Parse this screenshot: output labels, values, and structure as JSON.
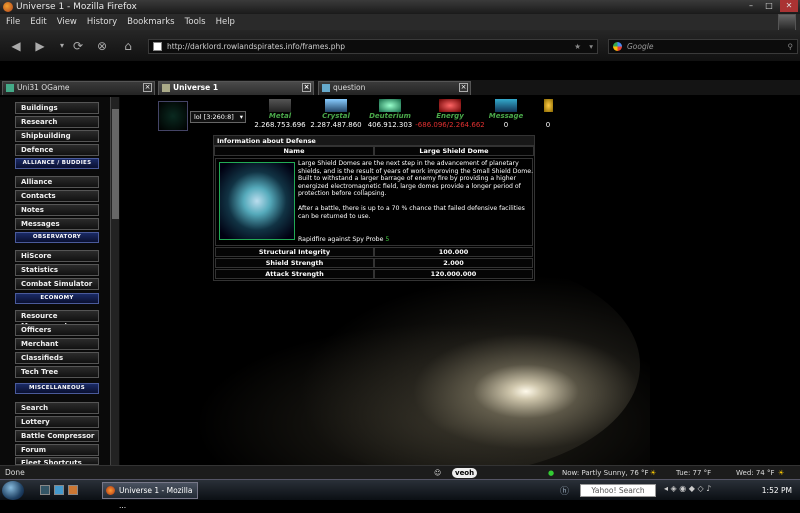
{
  "window": {
    "title": "Universe 1 - Mozilla Firefox"
  },
  "menu": [
    "File",
    "Edit",
    "View",
    "History",
    "Bookmarks",
    "Tools",
    "Help"
  ],
  "nav": {
    "url": "http://darklord.rowlandspirates.info/frames.php",
    "search_placeholder": "Google"
  },
  "tabs": [
    {
      "label": "Uni31 OGame",
      "active": false
    },
    {
      "label": "Universe 1",
      "active": true
    },
    {
      "label": "question",
      "active": false
    }
  ],
  "sidebar": {
    "items": [
      "Buildings",
      "Research",
      "Shipbuilding",
      "Defence"
    ],
    "header1": "ALLIANCE / BUDDIES",
    "items2": [
      "Alliance",
      "Contacts",
      "Notes",
      "Messages"
    ],
    "header2": "OBSERVATORY",
    "items3": [
      "HiScore",
      "Statistics",
      "Combat Simulator"
    ],
    "header3": "ECONOMY",
    "items4": [
      "Resource Managment",
      "Officers",
      "Merchant",
      "Classifieds",
      "Tech Tree"
    ],
    "header4": "MISCELLANEOUS",
    "items5": [
      "Search",
      "Lottery",
      "Battle Compressor",
      "Forum",
      "Fleet Shortcuts"
    ]
  },
  "planet": {
    "selector": "lol [3:260:8]"
  },
  "resources": [
    {
      "name": "Metal",
      "value": "2.268.753.696",
      "color": "#4aa84a"
    },
    {
      "name": "Crystal",
      "value": "2.287.487.860",
      "color": "#4aa84a"
    },
    {
      "name": "Deuterium",
      "value": "406.912.303",
      "color": "#4aa84a"
    },
    {
      "name": "Energy",
      "value": "-686.096/2.264.662",
      "color": "#4aa84a",
      "value_color": "#e03030"
    },
    {
      "name": "Message",
      "value": "0",
      "color": "#4aa84a"
    },
    {
      "name": "",
      "value": "0"
    }
  ],
  "info": {
    "header": "Information about Defense",
    "col_name": "Name",
    "item_name": "Large Shield Dome",
    "description": "Large Shield Domes are the next step in the advancement of planetary shields, and is the result of years of work improving the Small Shield Dome. Built to withstand a larger barrage of enemy fire by providing a higher energized electromagnetic field, large domes provide a longer period of protection before collapsing.",
    "description2": "After a battle, there is up to a 70 % chance that failed defensive facilities can be returned to use.",
    "rapidfire_label": "Rapidfire against Spy Probe",
    "rapidfire_value": "5",
    "stats": [
      {
        "label": "Structural Integrity",
        "value": "100.000"
      },
      {
        "label": "Shield Strength",
        "value": "2.000"
      },
      {
        "label": "Attack Strength",
        "value": "120.000.000"
      }
    ]
  },
  "status": {
    "text": "Done",
    "veoh": "veoh",
    "weather": "Now: Partly Sunny, 76 °F",
    "tue": "Tue: 77 °F",
    "wed": "Wed: 74 °F"
  },
  "taskbar": {
    "task": "Universe 1 - Mozilla ...",
    "search": "Yahoo! Search",
    "clock": "1:52 PM"
  }
}
